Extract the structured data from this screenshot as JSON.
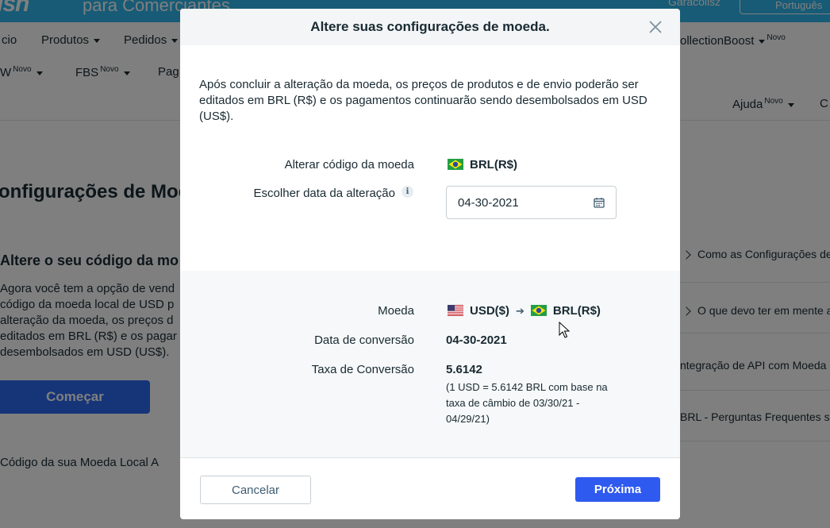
{
  "background": {
    "brand": "ish",
    "brand_sub": "para Comerciantes",
    "top_user": "Garacollsz",
    "top_lang": "Português",
    "nav": {
      "inicio": "cio",
      "produtos": "Produtos",
      "pedidos": "Pedidos",
      "collectionboost": "ollectionBoost",
      "collectionboost_badge": "Novo",
      "epcw": "W",
      "epcw_badge": "Novo",
      "fbs": "FBS",
      "fbs_badge": "Novo",
      "pag": "Pag",
      "ajuda": "Ajuda",
      "ajuda_badge": "Novo",
      "extra": "C"
    },
    "page_title": "onfigurações de Moe",
    "card_title": "Altere o seu código da mo",
    "card_text": "Agora você tem a opção de vend código da moeda local de USD p alteração da moeda, os preços d editados em BRL (R$) e os pagar desembolsados em USD (US$).",
    "start_button": "Começar",
    "bottom_link": "Código da sua Moeda Local A",
    "faq": [
      "Como as Configurações de",
      "O que devo ter em mente a",
      "ntegração de API com Moeda L",
      "BRL - Perguntas Frequentes sol"
    ]
  },
  "modal": {
    "title": "Altere suas configurações de moeda.",
    "intro": "Após concluir a alteração da moeda, os preços de produtos e de envio poderão ser editados em BRL (R$) e os pagamentos continuarão sendo desembolsados em USD (US$).",
    "change_code_label": "Alterar código da moeda",
    "change_code_value": "BRL(R$)",
    "choose_date_label": "Escolher data da alteração",
    "date_value": "04-30-2021",
    "currency_label": "Moeda",
    "currency_from": "USD($)",
    "currency_to": "BRL(R$)",
    "conversion_date_label": "Data de conversão",
    "conversion_date_value": "04-30-2021",
    "rate_label": "Taxa de Conversão",
    "rate_value": "5.6142",
    "rate_note": "(1 USD = 5.6142 BRL com base na taxa de câmbio de 03/30/21 - 04/29/21)",
    "cancel_label": "Cancelar",
    "next_label": "Próxima"
  },
  "colors": {
    "primary": "#2f5af0",
    "brand_blue": "#2fb7ec",
    "text": "#192a32"
  }
}
